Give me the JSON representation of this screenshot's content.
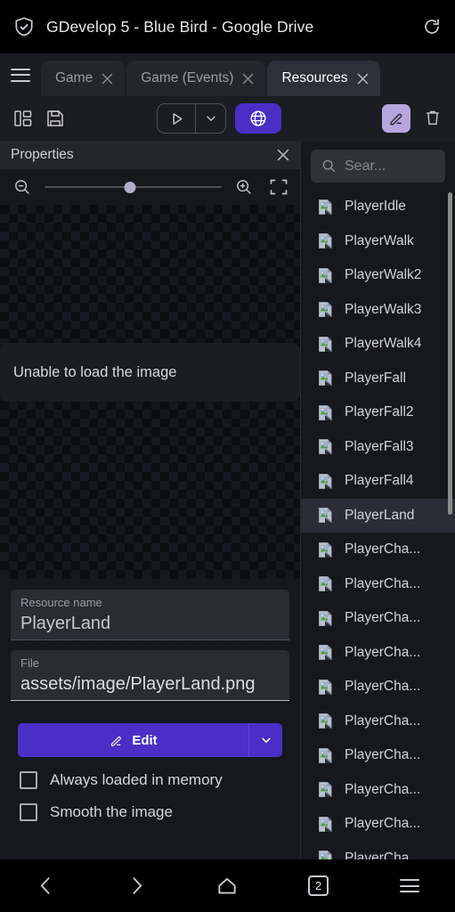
{
  "browser": {
    "security_icon": "shield-check-icon",
    "title": "GDevelop 5 - Blue Bird - Google Drive",
    "reload_icon": "reload-icon"
  },
  "tabstrip": {
    "menu_icon": "hamburger-menu-icon",
    "tabs": [
      {
        "label": "Game",
        "active": false,
        "close_icon": "close-icon"
      },
      {
        "label": "Game (Events)",
        "active": false,
        "close_icon": "close-icon"
      },
      {
        "label": "Resources",
        "active": true,
        "close_icon": "close-icon"
      }
    ]
  },
  "toolbar": {
    "layout_icon": "panel-layout-icon",
    "save_icon": "save-disk-icon",
    "preview_icon": "play-icon",
    "preview_caret_icon": "chevron-down-icon",
    "network_preview_icon": "globe-icon",
    "edit_icon": "pencil-icon",
    "delete_icon": "trash-icon",
    "accent_purple": "#4a2fc6",
    "accent_lilac": "#b6a5de"
  },
  "properties": {
    "title": "Properties",
    "close_icon": "close-icon",
    "zoom_out_icon": "zoom-out-icon",
    "zoom_in_icon": "zoom-in-icon",
    "fit_icon": "fit-to-frame-icon",
    "zoom_slider_percent": 48,
    "preview_error": "Unable to load the image",
    "resource_name_label": "Resource name",
    "resource_name_value": "PlayerLand",
    "file_label": "File",
    "file_value": "assets/image/PlayerLand.png",
    "edit_button_label": "Edit",
    "edit_button_caret_icon": "chevron-down-icon",
    "checkboxes": [
      {
        "label": "Always loaded in memory",
        "checked": false
      },
      {
        "label": "Smooth the image",
        "checked": false
      }
    ]
  },
  "resources_panel": {
    "search_icon": "search-icon",
    "search_placeholder": "Sear...",
    "search_value": "",
    "selected": "PlayerLand",
    "items": [
      {
        "label": "PlayerIdle",
        "icon": "broken-image-icon"
      },
      {
        "label": "PlayerWalk",
        "icon": "broken-image-icon"
      },
      {
        "label": "PlayerWalk2",
        "icon": "broken-image-icon"
      },
      {
        "label": "PlayerWalk3",
        "icon": "broken-image-icon"
      },
      {
        "label": "PlayerWalk4",
        "icon": "broken-image-icon"
      },
      {
        "label": "PlayerFall",
        "icon": "broken-image-icon"
      },
      {
        "label": "PlayerFall2",
        "icon": "broken-image-icon"
      },
      {
        "label": "PlayerFall3",
        "icon": "broken-image-icon"
      },
      {
        "label": "PlayerFall4",
        "icon": "broken-image-icon"
      },
      {
        "label": "PlayerLand",
        "icon": "broken-image-icon"
      },
      {
        "label": "PlayerCha...",
        "icon": "broken-image-icon"
      },
      {
        "label": "PlayerCha...",
        "icon": "broken-image-icon"
      },
      {
        "label": "PlayerCha...",
        "icon": "broken-image-icon"
      },
      {
        "label": "PlayerCha...",
        "icon": "broken-image-icon"
      },
      {
        "label": "PlayerCha...",
        "icon": "broken-image-icon"
      },
      {
        "label": "PlayerCha...",
        "icon": "broken-image-icon"
      },
      {
        "label": "PlayerCha...",
        "icon": "broken-image-icon"
      },
      {
        "label": "PlayerCha...",
        "icon": "broken-image-icon"
      },
      {
        "label": "PlayerCha...",
        "icon": "broken-image-icon"
      },
      {
        "label": "PlayerCha...",
        "icon": "broken-image-icon"
      }
    ]
  },
  "navbar": {
    "back_icon": "chevron-left-icon",
    "forward_icon": "chevron-right-icon",
    "home_icon": "home-icon",
    "tab_count": "2",
    "menu_icon": "hamburger-menu-icon"
  }
}
